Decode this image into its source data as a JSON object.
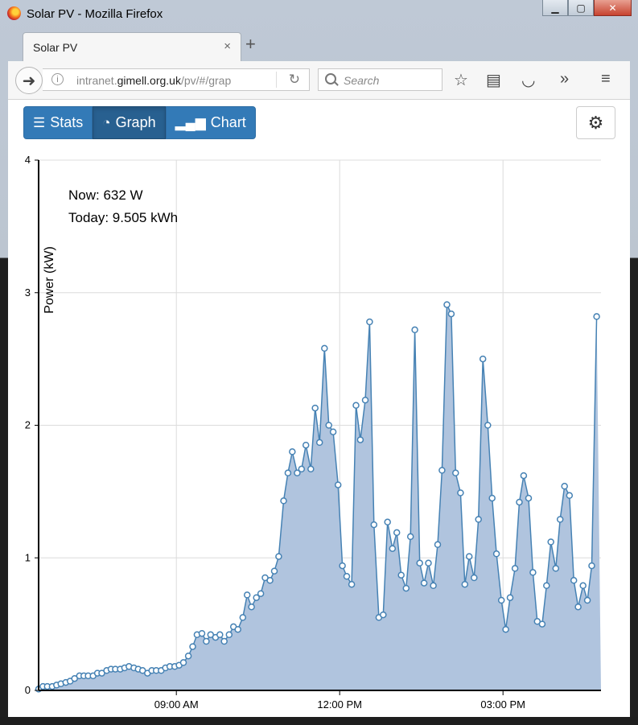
{
  "window": {
    "title": "Solar PV - Mozilla Firefox"
  },
  "tab": {
    "label": "Solar PV",
    "close": "×",
    "new": "+"
  },
  "urlbar": {
    "prefix": "intranet.",
    "host": "gimell.org.uk",
    "path": "/pv/#/grap"
  },
  "search": {
    "placeholder": "Search"
  },
  "nav": {
    "stats": "Stats",
    "graph": "Graph",
    "chart": "Chart",
    "active": "graph"
  },
  "summary": {
    "now": "Now: 632 W",
    "today": "Today: 9.505 kWh"
  },
  "colors": {
    "area_fill": "#b0c4de",
    "line": "#4682b4",
    "button_primary": "#337ab7"
  },
  "chart_data": {
    "type": "area",
    "ylabel": "Power (kW)",
    "ylim": [
      0,
      4
    ],
    "yticks": [
      "0",
      "1",
      "2",
      "3",
      "4"
    ],
    "xticks": [
      {
        "label": "09:00 AM",
        "t": 9.0
      },
      {
        "label": "12:00 PM",
        "t": 12.0
      },
      {
        "label": "03:00 PM",
        "t": 15.0
      }
    ],
    "xlim_hours": [
      6.47,
      16.8
    ],
    "grid": true,
    "series": [
      {
        "x_hours": [
          6.47,
          6.55,
          6.63,
          6.72,
          6.8,
          6.88,
          6.97,
          7.05,
          7.13,
          7.22,
          7.3,
          7.38,
          7.47,
          7.55,
          7.63,
          7.72,
          7.8,
          7.88,
          7.97,
          8.05,
          8.13,
          8.22,
          8.3,
          8.38,
          8.47,
          8.55,
          8.63,
          8.72,
          8.8,
          8.88,
          8.97,
          9.05,
          9.13,
          9.22,
          9.3,
          9.38,
          9.47,
          9.55,
          9.63,
          9.72,
          9.8,
          9.88,
          9.97,
          10.05,
          10.13,
          10.22,
          10.3,
          10.38,
          10.47,
          10.55,
          10.63,
          10.72,
          10.8,
          10.88,
          10.97,
          11.05,
          11.13,
          11.22,
          11.3,
          11.38,
          11.47,
          11.55,
          11.63,
          11.72,
          11.8,
          11.88,
          11.97,
          12.05,
          12.13,
          12.22,
          12.3,
          12.38,
          12.47,
          12.55,
          12.63,
          12.72,
          12.8,
          12.88,
          12.97,
          13.05,
          13.13,
          13.22,
          13.3,
          13.38,
          13.47,
          13.55,
          13.63,
          13.72,
          13.8,
          13.88,
          13.97,
          14.05,
          14.13,
          14.22,
          14.3,
          14.38,
          14.47,
          14.55,
          14.63,
          14.72,
          14.8,
          14.88,
          14.97,
          15.05,
          15.13,
          15.22,
          15.3,
          15.38,
          15.47,
          15.55,
          15.63,
          15.72,
          15.8,
          15.88,
          15.97,
          16.05,
          16.13,
          16.22,
          16.3,
          16.38,
          16.47,
          16.55,
          16.63,
          16.72,
          16.8
        ],
        "values": [
          0.01,
          0.03,
          0.03,
          0.03,
          0.04,
          0.05,
          0.06,
          0.07,
          0.09,
          0.11,
          0.11,
          0.11,
          0.11,
          0.13,
          0.13,
          0.15,
          0.16,
          0.16,
          0.16,
          0.17,
          0.18,
          0.17,
          0.16,
          0.15,
          0.13,
          0.15,
          0.15,
          0.15,
          0.17,
          0.18,
          0.18,
          0.19,
          0.21,
          0.26,
          0.33,
          0.42,
          0.43,
          0.37,
          0.42,
          0.4,
          0.42,
          0.37,
          0.42,
          0.48,
          0.46,
          0.55,
          0.72,
          0.63,
          0.7,
          0.73,
          0.85,
          0.83,
          0.9,
          1.01,
          1.43,
          1.64,
          1.8,
          1.64,
          1.67,
          1.85,
          1.67,
          2.13,
          1.87,
          2.58,
          2.0,
          1.95,
          1.55,
          0.94,
          0.86,
          0.8,
          2.15,
          1.89,
          2.19,
          2.78,
          1.25,
          0.55,
          0.57,
          1.27,
          1.07,
          1.19,
          0.87,
          0.77,
          1.16,
          2.72,
          0.96,
          0.81,
          0.96,
          0.79,
          1.1,
          1.66,
          2.91,
          2.84,
          1.64,
          1.49,
          0.8,
          1.01,
          0.85,
          1.29,
          2.5,
          2.0,
          1.45,
          1.03,
          0.68,
          0.46,
          0.7,
          0.92,
          1.42,
          1.62,
          1.45,
          0.89,
          0.52,
          0.5,
          0.79,
          1.12,
          0.92,
          1.29,
          1.54,
          1.47,
          0.83,
          0.63,
          0.79,
          0.68,
          0.94,
          2.82
        ]
      }
    ]
  }
}
